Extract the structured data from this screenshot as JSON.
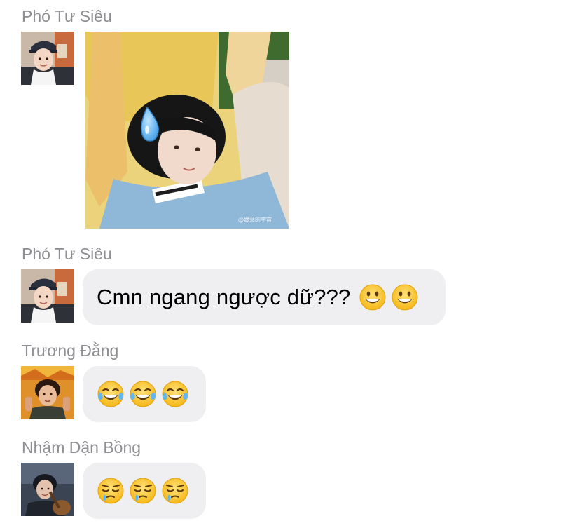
{
  "messages": [
    {
      "sender": "Phó Tư Siêu",
      "avatar_icon": "avatar-boy-cap-icon",
      "content_type": "sticker",
      "sticker_icon": "sweat-drop-sticker-icon",
      "watermark": "@媛菲的宇宙"
    },
    {
      "sender": "Phó Tư Siêu",
      "avatar_icon": "avatar-boy-cap-icon",
      "content_type": "text",
      "text": "Cmn ngang ngược dữ???",
      "emojis": [
        "grinning-face-icon",
        "grinning-face-icon"
      ]
    },
    {
      "sender": "Trương Đằng",
      "avatar_icon": "avatar-boy-orange-icon",
      "content_type": "emoji",
      "emojis": [
        "tears-of-joy-icon",
        "tears-of-joy-icon",
        "tears-of-joy-icon"
      ]
    },
    {
      "sender": "Nhậm Dận Bồng",
      "avatar_icon": "avatar-boy-guitar-icon",
      "content_type": "emoji",
      "emojis": [
        "sleepy-face-icon",
        "sleepy-face-icon",
        "sleepy-face-icon"
      ]
    }
  ],
  "colors": {
    "sender_name": "#8e8e93",
    "bubble_bg": "#efeff1",
    "text": "#000000",
    "background": "#ffffff"
  }
}
